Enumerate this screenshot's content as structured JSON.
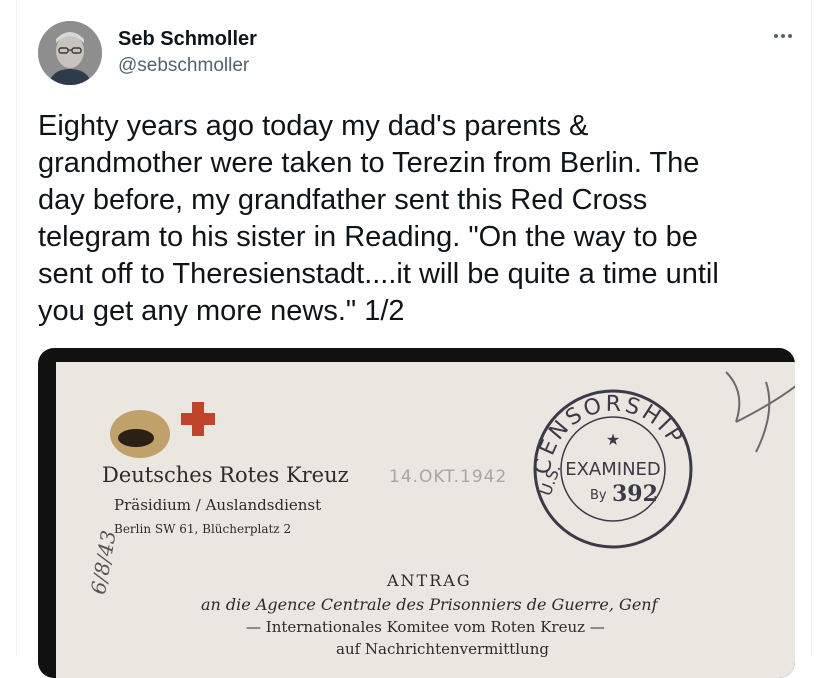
{
  "author": {
    "display_name": "Seb Schmoller",
    "handle": "@sebschmoller"
  },
  "tweet": {
    "text": "Eighty years ago today my dad's parents &\ngrandmother were taken to Terezin from Berlin. The\nday before, my grandfather sent this Red Cross\ntelegram to his sister in Reading. \"On the way to be\nsent off to Theresienstadt....it will be quite a time until\nyou get any more news.\" 1/2"
  },
  "document": {
    "org_name": "Deutsches Rotes Kreuz",
    "dept": "Präsidium / Auslandsdienst",
    "address": "Berlin SW 61, Blücherplatz 2",
    "stamp_date": "14.OKT.1942",
    "heading": "ANTRAG",
    "line1": "an die Agence Centrale des Prisonniers de Guerre, Genf",
    "line2": "— Internationales Komitee vom Roten Kreuz —",
    "line3": "auf Nachrichtenvermittlung",
    "handwritten_left": "6/8/43",
    "censor": {
      "top": "CENSORSHIP",
      "left": "U.S.",
      "center": "EXAMINED",
      "by": "By",
      "number": "392"
    }
  },
  "colors": {
    "text_primary": "#0f1419",
    "text_secondary": "#536471",
    "red_cross": "#c0432a",
    "stamp_ink": "#3a3a48"
  }
}
